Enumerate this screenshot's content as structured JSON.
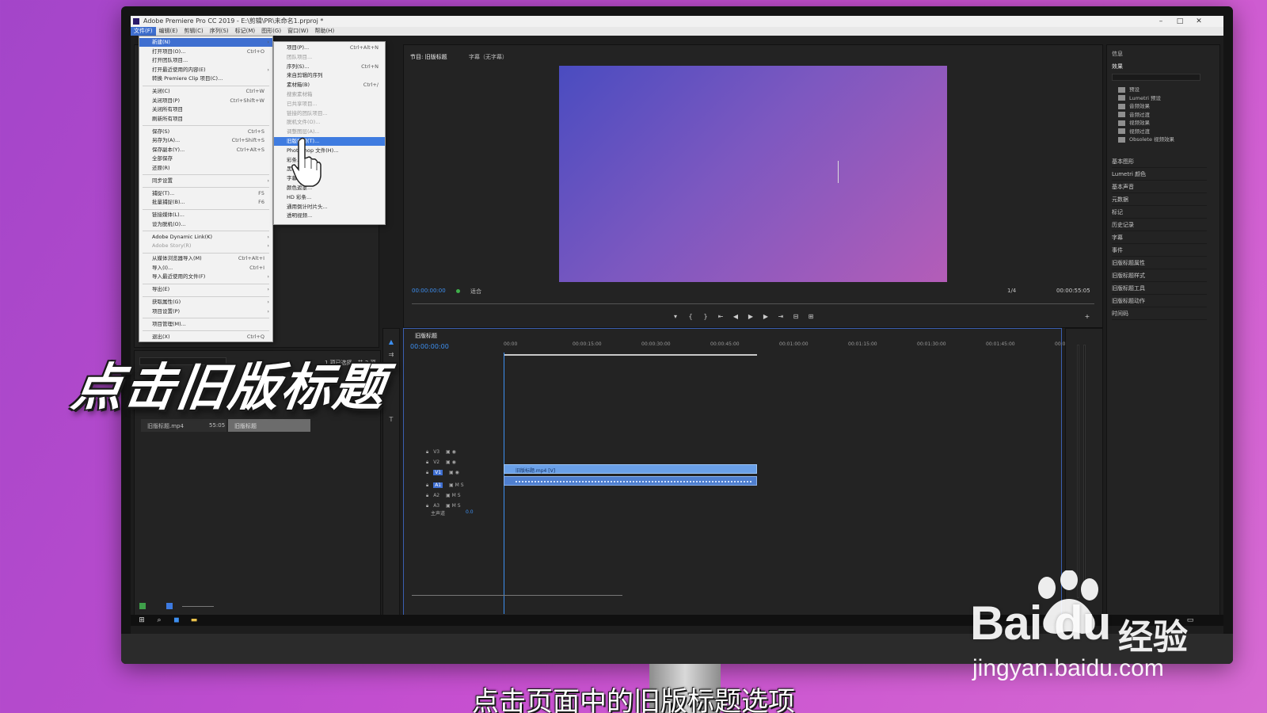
{
  "window": {
    "title": "Adobe Premiere Pro CC 2019 - E:\\剪辑\\PR\\未命名1.prproj *",
    "minimize_icon": "minimize-icon",
    "maximize_icon": "maximize-icon",
    "close_icon": "close-icon"
  },
  "menubar": [
    "文件(F)",
    "编辑(E)",
    "剪辑(C)",
    "序列(S)",
    "标记(M)",
    "图形(G)",
    "窗口(W)",
    "帮助(H)"
  ],
  "file_menu": {
    "items": [
      {
        "label": "新建(N)",
        "shortcut": "",
        "arrow": "›"
      },
      {
        "label": "打开项目(O)...",
        "shortcut": "Ctrl+O",
        "arrow": ""
      },
      {
        "label": "打开团队项目...",
        "shortcut": "",
        "arrow": ""
      },
      {
        "label": "打开最近使用的内容(E)",
        "shortcut": "",
        "arrow": "›"
      },
      {
        "label": "转换 Premiere Clip 项目(C)...",
        "shortcut": "",
        "arrow": ""
      },
      {
        "label": "关闭(C)",
        "shortcut": "Ctrl+W",
        "arrow": ""
      },
      {
        "label": "关闭项目(P)",
        "shortcut": "Ctrl+Shift+W",
        "arrow": ""
      },
      {
        "label": "关闭所有项目",
        "shortcut": "",
        "arrow": ""
      },
      {
        "label": "刷新所有项目",
        "shortcut": "",
        "arrow": ""
      },
      {
        "label": "保存(S)",
        "shortcut": "Ctrl+S",
        "arrow": ""
      },
      {
        "label": "另存为(A)...",
        "shortcut": "Ctrl+Shift+S",
        "arrow": ""
      },
      {
        "label": "保存副本(Y)...",
        "shortcut": "Ctrl+Alt+S",
        "arrow": ""
      },
      {
        "label": "全部保存",
        "shortcut": "",
        "arrow": ""
      },
      {
        "label": "还原(R)",
        "shortcut": "",
        "arrow": ""
      },
      {
        "label": "同步设置",
        "shortcut": "",
        "arrow": "›"
      },
      {
        "label": "捕捉(T)...",
        "shortcut": "F5",
        "arrow": ""
      },
      {
        "label": "批量捕捉(B)...",
        "shortcut": "F6",
        "arrow": ""
      },
      {
        "label": "链接媒体(L)...",
        "shortcut": "",
        "arrow": ""
      },
      {
        "label": "设为脱机(O)...",
        "shortcut": "",
        "arrow": ""
      },
      {
        "label": "Adobe Dynamic Link(K)",
        "shortcut": "",
        "arrow": "›"
      },
      {
        "label": "Adobe Story(R)",
        "shortcut": "",
        "arrow": "›"
      },
      {
        "label": "从媒体浏览器导入(M)",
        "shortcut": "Ctrl+Alt+I",
        "arrow": ""
      },
      {
        "label": "导入(I)...",
        "shortcut": "Ctrl+I",
        "arrow": ""
      },
      {
        "label": "导入最近使用的文件(F)",
        "shortcut": "",
        "arrow": "›"
      },
      {
        "label": "导出(E)",
        "shortcut": "",
        "arrow": "›"
      },
      {
        "label": "获取属性(G)",
        "shortcut": "",
        "arrow": "›"
      },
      {
        "label": "项目设置(P)",
        "shortcut": "",
        "arrow": "›"
      },
      {
        "label": "项目管理(M)...",
        "shortcut": "",
        "arrow": ""
      },
      {
        "label": "退出(X)",
        "shortcut": "Ctrl+Q",
        "arrow": ""
      }
    ]
  },
  "new_submenu": {
    "items": [
      {
        "label": "项目(P)...",
        "shortcut": "Ctrl+Alt+N"
      },
      {
        "label": "团队项目...",
        "shortcut": ""
      },
      {
        "label": "序列(S)...",
        "shortcut": "Ctrl+N"
      },
      {
        "label": "来自剪辑的序列",
        "shortcut": ""
      },
      {
        "label": "素材箱(B)",
        "shortcut": "Ctrl+/"
      },
      {
        "label": "搜索素材箱",
        "shortcut": ""
      },
      {
        "label": "已共享项目...",
        "shortcut": ""
      },
      {
        "label": "链接的团队项目...",
        "shortcut": ""
      },
      {
        "label": "脱机文件(O)...",
        "shortcut": ""
      },
      {
        "label": "调整图层(A)...",
        "shortcut": ""
      },
      {
        "label": "旧版标题(T)...",
        "shortcut": ""
      },
      {
        "label": "Photoshop 文件(H)...",
        "shortcut": ""
      },
      {
        "label": "彩条...",
        "shortcut": ""
      },
      {
        "label": "黑场视频...",
        "shortcut": ""
      },
      {
        "label": "字幕...",
        "shortcut": ""
      },
      {
        "label": "颜色遮罩...",
        "shortcut": ""
      },
      {
        "label": "HD 彩条...",
        "shortcut": ""
      },
      {
        "label": "通用倒计时片头...",
        "shortcut": ""
      },
      {
        "label": "透明视频...",
        "shortcut": ""
      }
    ]
  },
  "program_monitor": {
    "tab_active": "节目: 旧版标题",
    "tab_other": "字幕（无字幕）",
    "timecode_left": "00:00:00:00",
    "fit": "适合",
    "zoom": "1/4",
    "timecode_right": "00:00:55:05"
  },
  "transport": [
    "mark-in-icon",
    "mark-out-icon",
    "go-to-in-icon",
    "step-back-icon",
    "play-icon",
    "step-forward-icon",
    "go-to-out-icon",
    "lift-icon",
    "extract-icon",
    "export-frame-icon"
  ],
  "timeline": {
    "tab": "旧版标题",
    "timecode": "00:00:00:00",
    "ruler": [
      "00:00",
      "00:00:15:00",
      "00:00:30:00",
      "00:00:45:00",
      "00:01:00:00",
      "00:01:15:00",
      "00:01:30:00",
      "00:01:45:00",
      "00:02"
    ],
    "tracks": [
      "V3",
      "V2",
      "V1",
      "A1",
      "A2",
      "A3"
    ],
    "master_label": "主声道",
    "master_value": "0.0",
    "video_clip": "旧版标题.mp4 [V]",
    "playhead_progress": 0.02
  },
  "project_panel": {
    "item_name": "旧版标题.mp4",
    "item_duration": "55:05",
    "selected": "1 项已选择，共 2 项",
    "sequence_name": "旧版标题"
  },
  "effects_panel": {
    "title": "信息",
    "subtitle": "效果",
    "folders": [
      "预设",
      "Lumetri 预设",
      "音频效果",
      "音频过渡",
      "视频效果",
      "视频过渡",
      "Obsolete 视频效果"
    ],
    "panels": [
      "基本图形",
      "Lumetri 颜色",
      "基本声音",
      "元数据",
      "标记",
      "历史记录",
      "字幕",
      "事件",
      "旧版标题属性",
      "旧版标题样式",
      "旧版标题工具",
      "旧版标题动作",
      "时间码"
    ]
  },
  "taskbar": {
    "icons": [
      "windows-start-icon",
      "search-icon",
      "edge-icon",
      "folder-icon"
    ]
  },
  "captions": {
    "big": "点击旧版标题",
    "bottom": "点击页面中的旧版标题选项"
  },
  "watermark": {
    "logo": "Bai du",
    "brand": "经验",
    "url": "jingyan.baidu.com"
  },
  "colors": {
    "accent": "#3f6fd0",
    "timecode": "#3d8ff0",
    "clip": "#5c8ad6",
    "background": "#c04cd0"
  }
}
